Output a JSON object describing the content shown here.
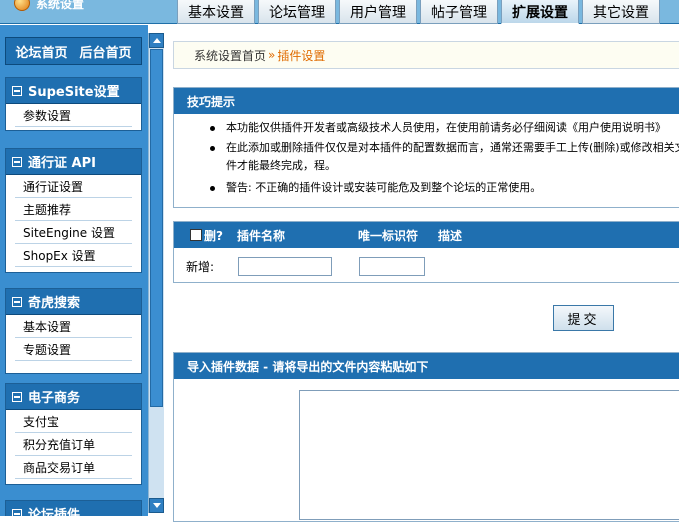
{
  "topbar": {
    "logo_text": "系统设置",
    "tabs": [
      {
        "label": "基本设置",
        "active": false
      },
      {
        "label": "论坛管理",
        "active": false
      },
      {
        "label": "用户管理",
        "active": false
      },
      {
        "label": "帖子管理",
        "active": false
      },
      {
        "label": "扩展设置",
        "active": true
      },
      {
        "label": "其它设置",
        "active": false
      }
    ]
  },
  "sidebar": {
    "home_links": [
      "论坛首页",
      "后台首页"
    ],
    "groups": [
      {
        "title": "SupeSite设置",
        "items": [
          "参数设置"
        ]
      },
      {
        "title": "通行证 API",
        "items": [
          "通行证设置",
          "主题推荐",
          "SiteEngine 设置",
          "ShopEx 设置"
        ]
      },
      {
        "title": "奇虎搜索",
        "items": [
          "基本设置",
          "专题设置"
        ]
      },
      {
        "title": "电子商务",
        "items": [
          "支付宝",
          "积分充值订单",
          "商品交易订单"
        ]
      },
      {
        "title": "论坛插件",
        "items": []
      }
    ]
  },
  "breadcrumb": {
    "root": "系统设置首页",
    "separator": "»",
    "current": "插件设置"
  },
  "tips": {
    "title": "技巧提示",
    "items": [
      "本功能仅供插件开发者或高级技术人员使用，在使用前请务必仔细阅读《用户使用说明书》",
      "在此添加或删除插件仅仅是对本插件的配置数据而言，通常还需要手工上传(删除)或修改相关文件才能最终完成，程。",
      "警告: 不正确的插件设计或安装可能危及到整个论坛的正常使用。"
    ]
  },
  "plugins_table": {
    "columns": {
      "delete": "删?",
      "name": "插件名称",
      "identifier": "唯一标识符",
      "description": "描述"
    },
    "add_label": "新增:",
    "name_value": "",
    "identifier_value": ""
  },
  "submit_label": "提交",
  "import": {
    "title": "导入插件数据 - 请将导出的文件内容粘贴如下",
    "content": ""
  }
}
